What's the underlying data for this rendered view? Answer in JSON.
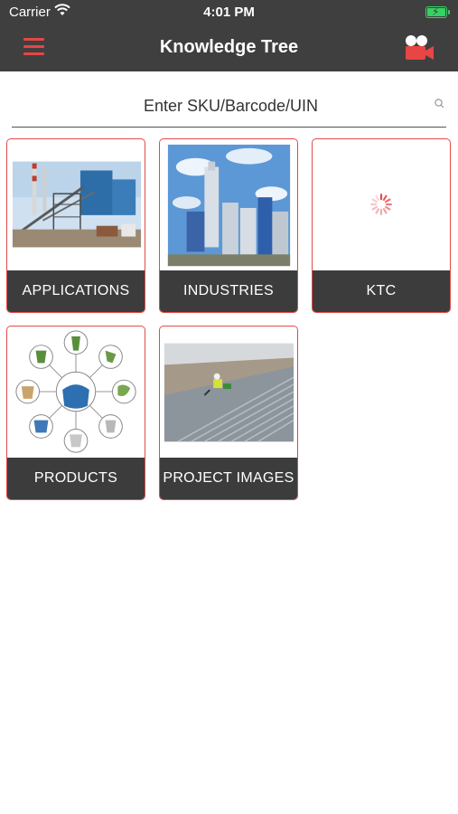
{
  "status_bar": {
    "carrier": "Carrier",
    "time": "4:01 PM"
  },
  "header": {
    "title": "Knowledge Tree"
  },
  "search": {
    "placeholder": "Enter SKU/Barcode/UIN"
  },
  "tiles": [
    {
      "label": "APPLICATIONS"
    },
    {
      "label": "INDUSTRIES"
    },
    {
      "label": "KTC"
    },
    {
      "label": "PRODUCTS"
    },
    {
      "label": "PROJECT IMAGES"
    }
  ],
  "colors": {
    "accent": "#e84545",
    "header_bg": "#3f3f3f",
    "tile_border": "#e14b4b",
    "label_bg": "#3c3c3c"
  }
}
